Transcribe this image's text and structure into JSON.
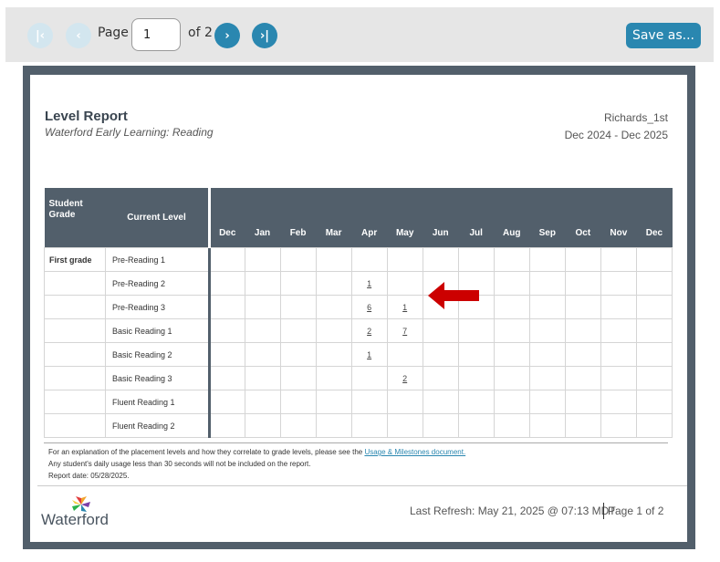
{
  "toolbar": {
    "page_label": "Page",
    "page_value": "1",
    "of_label": "of 2",
    "save_label": "Save as..."
  },
  "report": {
    "title": "Level Report",
    "subtitle": "Waterford Early Learning: Reading",
    "class_name": "Richards_1st",
    "date_range": "Dec 2024 - Dec 2025",
    "headers": {
      "student_grade": "Student Grade",
      "current_level": "Current Level",
      "months": [
        "Dec",
        "Jan",
        "Feb",
        "Mar",
        "Apr",
        "May",
        "Jun",
        "Jul",
        "Aug",
        "Sep",
        "Oct",
        "Nov",
        "Dec"
      ]
    },
    "rows": [
      {
        "grade": "First grade",
        "level": "Pre-Reading 1",
        "counts": [
          "",
          "",
          "",
          "",
          "",
          "",
          "",
          "",
          "",
          "",
          "",
          "",
          ""
        ]
      },
      {
        "grade": "",
        "level": "Pre-Reading 2",
        "counts": [
          "",
          "",
          "",
          "",
          "1",
          "",
          "",
          "",
          "",
          "",
          "",
          "",
          ""
        ]
      },
      {
        "grade": "",
        "level": "Pre-Reading 3",
        "counts": [
          "",
          "",
          "",
          "",
          "6",
          "1",
          "",
          "",
          "",
          "",
          "",
          "",
          ""
        ]
      },
      {
        "grade": "",
        "level": "Basic Reading 1",
        "counts": [
          "",
          "",
          "",
          "",
          "2",
          "7",
          "",
          "",
          "",
          "",
          "",
          "",
          ""
        ]
      },
      {
        "grade": "",
        "level": "Basic Reading 2",
        "counts": [
          "",
          "",
          "",
          "",
          "1",
          "",
          "",
          "",
          "",
          "",
          "",
          "",
          ""
        ]
      },
      {
        "grade": "",
        "level": "Basic Reading 3",
        "counts": [
          "",
          "",
          "",
          "",
          "",
          "2",
          "",
          "",
          "",
          "",
          "",
          "",
          ""
        ]
      },
      {
        "grade": "",
        "level": "Fluent Reading 1",
        "counts": [
          "",
          "",
          "",
          "",
          "",
          "",
          "",
          "",
          "",
          "",
          "",
          "",
          ""
        ]
      },
      {
        "grade": "",
        "level": "Fluent Reading 2",
        "counts": [
          "",
          "",
          "",
          "",
          "",
          "",
          "",
          "",
          "",
          "",
          "",
          "",
          ""
        ]
      }
    ],
    "notes": {
      "line1_text": "For an explanation of the placement levels and how they correlate to grade levels, please see the ",
      "line1_link": "Usage & Milestones document.",
      "line2": "Any student's daily usage less than 30 seconds will not be included on the report.",
      "line3": "Report date: 05/28/2025."
    },
    "footer": {
      "logo_text": "Waterford",
      "last_refresh": "Last Refresh: May 21, 2025 @ 07:13 MDT",
      "page_of": "Page 1 of 2"
    }
  },
  "colors": {
    "accent": "#2a87b0",
    "header_bg": "#525f6b",
    "arrow": "#cc0000"
  },
  "icons": {
    "first": "double-chevron-left-icon",
    "prev": "chevron-left-icon",
    "next": "chevron-right-icon",
    "last": "double-chevron-right-icon"
  }
}
